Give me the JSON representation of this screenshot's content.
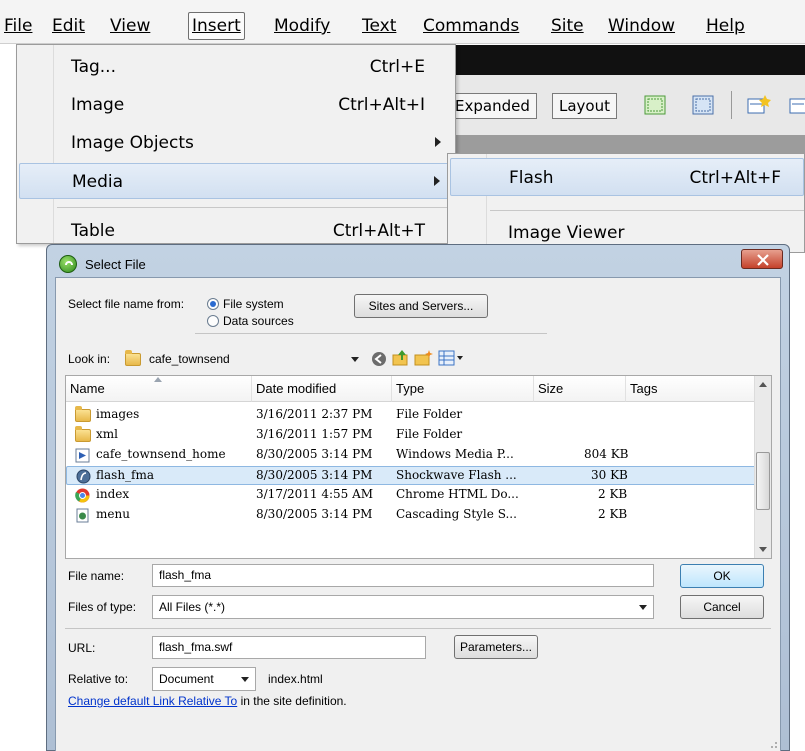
{
  "menubar": {
    "items": [
      {
        "label": "File",
        "mnemonic_index": 0
      },
      {
        "label": "Edit"
      },
      {
        "label": "View"
      },
      {
        "label": "Insert"
      },
      {
        "label": "Modify"
      },
      {
        "label": "Text"
      },
      {
        "label": "Commands"
      },
      {
        "label": "Site"
      },
      {
        "label": "Window"
      },
      {
        "label": "Help"
      }
    ],
    "active": "Insert"
  },
  "toolbar": {
    "expanded_label": "Expanded",
    "layout_label": "Layout"
  },
  "insert_menu": {
    "items": [
      {
        "label": "Tag...",
        "shortcut": "Ctrl+E"
      },
      {
        "label": "Image",
        "shortcut": "Ctrl+Alt+I"
      },
      {
        "label": "Image Objects",
        "shortcut": ""
      },
      {
        "label": "Media",
        "shortcut": ""
      },
      {
        "label": "Table",
        "shortcut": "Ctrl+Alt+T"
      }
    ],
    "highlighted": "Media"
  },
  "media_submenu": {
    "items": [
      {
        "label": "Flash",
        "shortcut": "Ctrl+Alt+F"
      },
      {
        "label": "Image Viewer",
        "shortcut": ""
      }
    ]
  },
  "dialog": {
    "title": "Select File",
    "select_from_label": "Select file name from:",
    "radio_filesystem": "File system",
    "radio_datasources": "Data sources",
    "sites_button": "Sites and Servers...",
    "lookin_label": "Look in:",
    "lookin_value": "cafe_townsend",
    "columns": {
      "name": "Name",
      "date": "Date modified",
      "type": "Type",
      "size": "Size",
      "tags": "Tags"
    },
    "files": [
      {
        "name": "images",
        "date": "3/16/2011 2:37 PM",
        "type": "File Folder",
        "size": "",
        "icon": "folder-icon"
      },
      {
        "name": "xml",
        "date": "3/16/2011 1:57 PM",
        "type": "File Folder",
        "size": "",
        "icon": "folder-icon"
      },
      {
        "name": "cafe_townsend_home",
        "date": "8/30/2005 3:14 PM",
        "type": "Windows Media P...",
        "size": "804 KB",
        "icon": "media-file-icon"
      },
      {
        "name": "flash_fma",
        "date": "8/30/2005 3:14 PM",
        "type": "Shockwave Flash ...",
        "size": "30 KB",
        "icon": "flash-file-icon"
      },
      {
        "name": "index",
        "date": "3/17/2011 4:55 AM",
        "type": "Chrome HTML Do...",
        "size": "2 KB",
        "icon": "chrome-icon"
      },
      {
        "name": "menu",
        "date": "8/30/2005 3:14 PM",
        "type": "Cascading Style S...",
        "size": "2 KB",
        "icon": "css-file-icon"
      }
    ],
    "selected_file": "flash_fma",
    "filename_label": "File name:",
    "filename_value": "flash_fma",
    "ok_button": "OK",
    "filetype_label": "Files of type:",
    "filetype_value": "All Files (*.*)",
    "cancel_button": "Cancel",
    "url_label": "URL:",
    "url_value": "flash_fma.swf",
    "parameters_button": "Parameters...",
    "relative_label": "Relative to:",
    "relative_value": "Document",
    "relative_file": "index.html",
    "link_text": "Change default Link Relative To",
    "link_suffix": " in the site definition."
  }
}
